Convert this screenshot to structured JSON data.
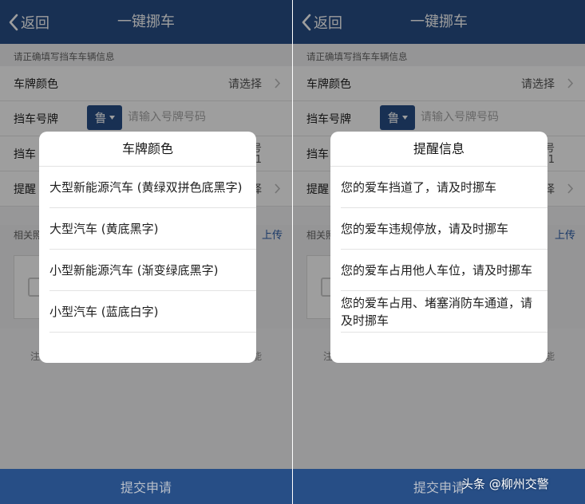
{
  "left": {
    "nav": {
      "back_label": "返回",
      "title": "一键挪车"
    },
    "section_hint": "请正确填写挡车车辆信息",
    "rows": {
      "plate_color_label": "车牌颜色",
      "plate_color_value": "请选择",
      "plate_number_label": "挡车号牌",
      "province": "鲁",
      "plate_placeholder": "请输入号牌号码",
      "row3_label_fragment": "挡车",
      "row3_right_fragment_1": "号",
      "row3_right_fragment_2": "1",
      "row4_label_fragment": "提醒",
      "row4_right_fragment": "择"
    },
    "upload": {
      "label_fragment": "相关照",
      "link_fragment": "上传"
    },
    "note": {
      "left_fragment": "注",
      "right_fragment": "能"
    },
    "submit_label": "提交申请",
    "modal": {
      "title": "车牌颜色",
      "items": [
        "大型新能源汽车 (黄绿双拼色底黑字)",
        "大型汽车 (黄底黑字)",
        "小型新能源汽车 (渐变绿底黑字)",
        "小型汽车 (蓝底白字)"
      ]
    }
  },
  "right": {
    "nav": {
      "back_label": "返回",
      "title": "一键挪车"
    },
    "section_hint": "请正确填写挡车车辆信息",
    "rows": {
      "plate_color_label": "车牌颜色",
      "plate_color_value": "请选择",
      "plate_number_label": "挡车号牌",
      "province": "鲁",
      "plate_placeholder": "请输入号牌号码",
      "row3_label_fragment": "挡车",
      "row3_right_fragment_1": "号",
      "row3_right_fragment_2": "1",
      "row4_label_fragment": "提醒",
      "row4_right_fragment": "择"
    },
    "upload": {
      "label_fragment": "相关照",
      "link_fragment": "上传"
    },
    "note": {
      "left_fragment": "注",
      "right_fragment": "能"
    },
    "submit_label": "提交申请",
    "modal": {
      "title": "提醒信息",
      "items": [
        "您的爱车挡道了，请及时挪车",
        "您的爱车违规停放，请及时挪车",
        "您的爱车占用他人车位，请及时挪车",
        "您的爱车占用、堵塞消防车通道，请及时挪车"
      ]
    }
  },
  "watermark": "头条 @柳州交警",
  "colors": {
    "brand_blue": "#274e86",
    "link_blue": "#2b5da8",
    "overlay": "rgba(0,0,0,0.38)"
  },
  "icons": {
    "back": "chevron-left-icon",
    "row_arrow": "chevron-right-icon",
    "dropdown": "caret-down-icon",
    "upload_placeholder": "image-placeholder-icon"
  }
}
